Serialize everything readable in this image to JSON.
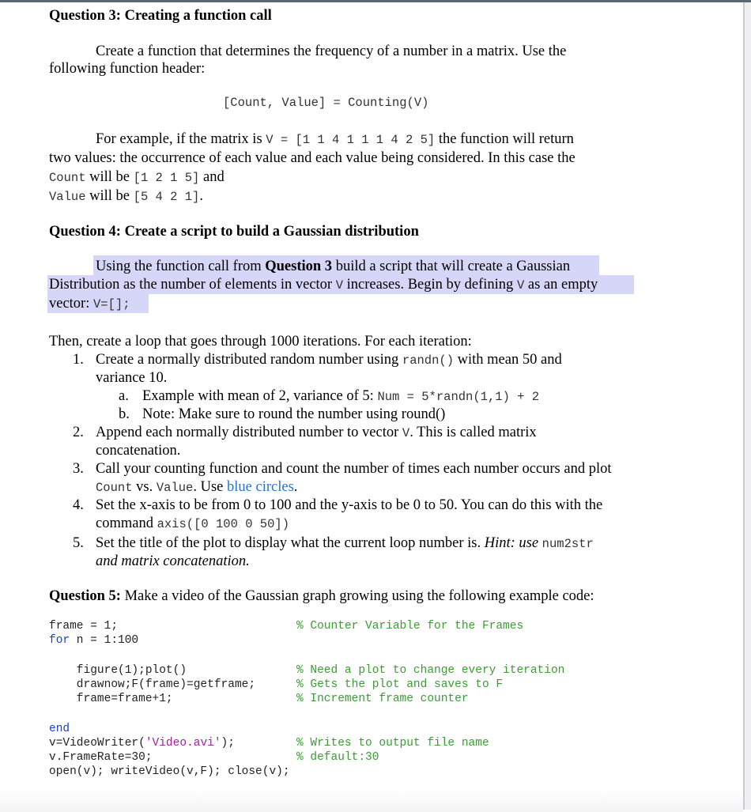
{
  "q3": {
    "heading": "Question 3: Creating a function call",
    "p1_line1": "Create a function that determines the frequency of a number in a matrix. Use the",
    "p1_line2": "following function header:",
    "header_code": "[Count, Value] = Counting(V)",
    "p2_line1_pre": "For example, if the matrix is ",
    "p2_line1_code": "V = [1 1 4 1 1 1 4 2 5]",
    "p2_line1_post": " the function will return",
    "p2_line2": "two values: the occurrence of each value and each value being considered. In this case the",
    "p2_line3_code1": "Count",
    "p2_line3_mid": " will be ",
    "p2_line3_code2": "[1 2 1 5]",
    "p2_line3_post": " and",
    "p2_line4_code1": "Value",
    "p2_line4_mid": " will be ",
    "p2_line4_code2": "[5 4 2 1]",
    "p2_line4_post": "."
  },
  "q4": {
    "heading": "Question 4: Create a script to build a Gaussian distribution",
    "p1_line1_pre": "Using the function call from ",
    "p1_line1_bold": "Question 3",
    "p1_line1_post": " build a script that will create a Gaussian",
    "p1_line2_pre": "Distribution as the number of elements in vector ",
    "p1_line2_code1": "V",
    "p1_line2_mid": " increases. Begin by defining ",
    "p1_line2_code2": "V",
    "p1_line2_post": " as an empty",
    "p1_line3_pre": "vector: ",
    "p1_line3_code": "V=[];",
    "intro": "Then, create a loop that goes through 1000 iterations. For each iteration:",
    "items": [
      {
        "num": "1.",
        "line1_pre": "Create a normally distributed random number using ",
        "line1_code": "randn()",
        "line1_post": " with mean 50 and",
        "line2": "variance 10."
      },
      {
        "num": "2.",
        "line1": "Append each normally distributed number to vector ",
        "line1_code": "V",
        "line1_post": ". This is called matrix",
        "line2": "concatenation."
      },
      {
        "num": "3.",
        "line1": "Call your counting function and count the number of times each number occurs and plot",
        "line2_code1": "Count",
        "line2_mid": " vs. ",
        "line2_code2": "Value",
        "line2_mid2": ". Use ",
        "line2_link": "blue circles",
        "line2_post": "."
      },
      {
        "num": "4.",
        "line1": "Set the x-axis to be from 0 to 100 and the y-axis to be 0 to 50. You can do this with the",
        "line2_pre": "command ",
        "line2_code": "axis([0 100 0 50])"
      },
      {
        "num": "5.",
        "line1_pre": "Set the title of the plot to display what the current loop number is. ",
        "line1_italic": "Hint: use ",
        "line1_code": "num2str",
        "line2_italic": "and matrix concatenation."
      }
    ],
    "subitems": [
      {
        "letter": "a.",
        "pre": "Example with mean of 2, variance of 5: ",
        "code": "Num = 5*randn(1,1) + 2"
      },
      {
        "letter": "b.",
        "text": "Note: Make sure to round the number using round()"
      }
    ]
  },
  "q5": {
    "heading_bold": "Question 5:",
    "heading_rest": " Make a video of the Gaussian graph growing using the following example code:",
    "code": [
      {
        "code": "frame = 1;",
        "comment": "% Counter Variable for the Frames"
      },
      {
        "kw": "for",
        "code": " n = 1:100",
        "comment": ""
      },
      {
        "code": "    figure(1);plot()",
        "comment": "% Need a plot to change every iteration"
      },
      {
        "code": "    drawnow;F(frame)=getframe;",
        "comment": "% Gets the plot and saves to F"
      },
      {
        "code": "    frame=frame+1;",
        "comment": "% Increment frame counter"
      },
      {
        "kw": "end",
        "code": "",
        "comment": ""
      },
      {
        "code_pre": "v=VideoWriter(",
        "str": "'Video.avi'",
        "code_post": ");",
        "comment": "% Writes to output file name"
      },
      {
        "code": "v.FrameRate=30;",
        "comment": "% default:30"
      },
      {
        "code": "open(v); writeVideo(v,F); close(v);",
        "comment": ""
      }
    ]
  },
  "colors": {
    "highlight": "#d6d6f8",
    "keyword": "#1a3fcf",
    "string": "#a0239d",
    "comment": "#3c9b34",
    "link": "#2c73c2"
  }
}
